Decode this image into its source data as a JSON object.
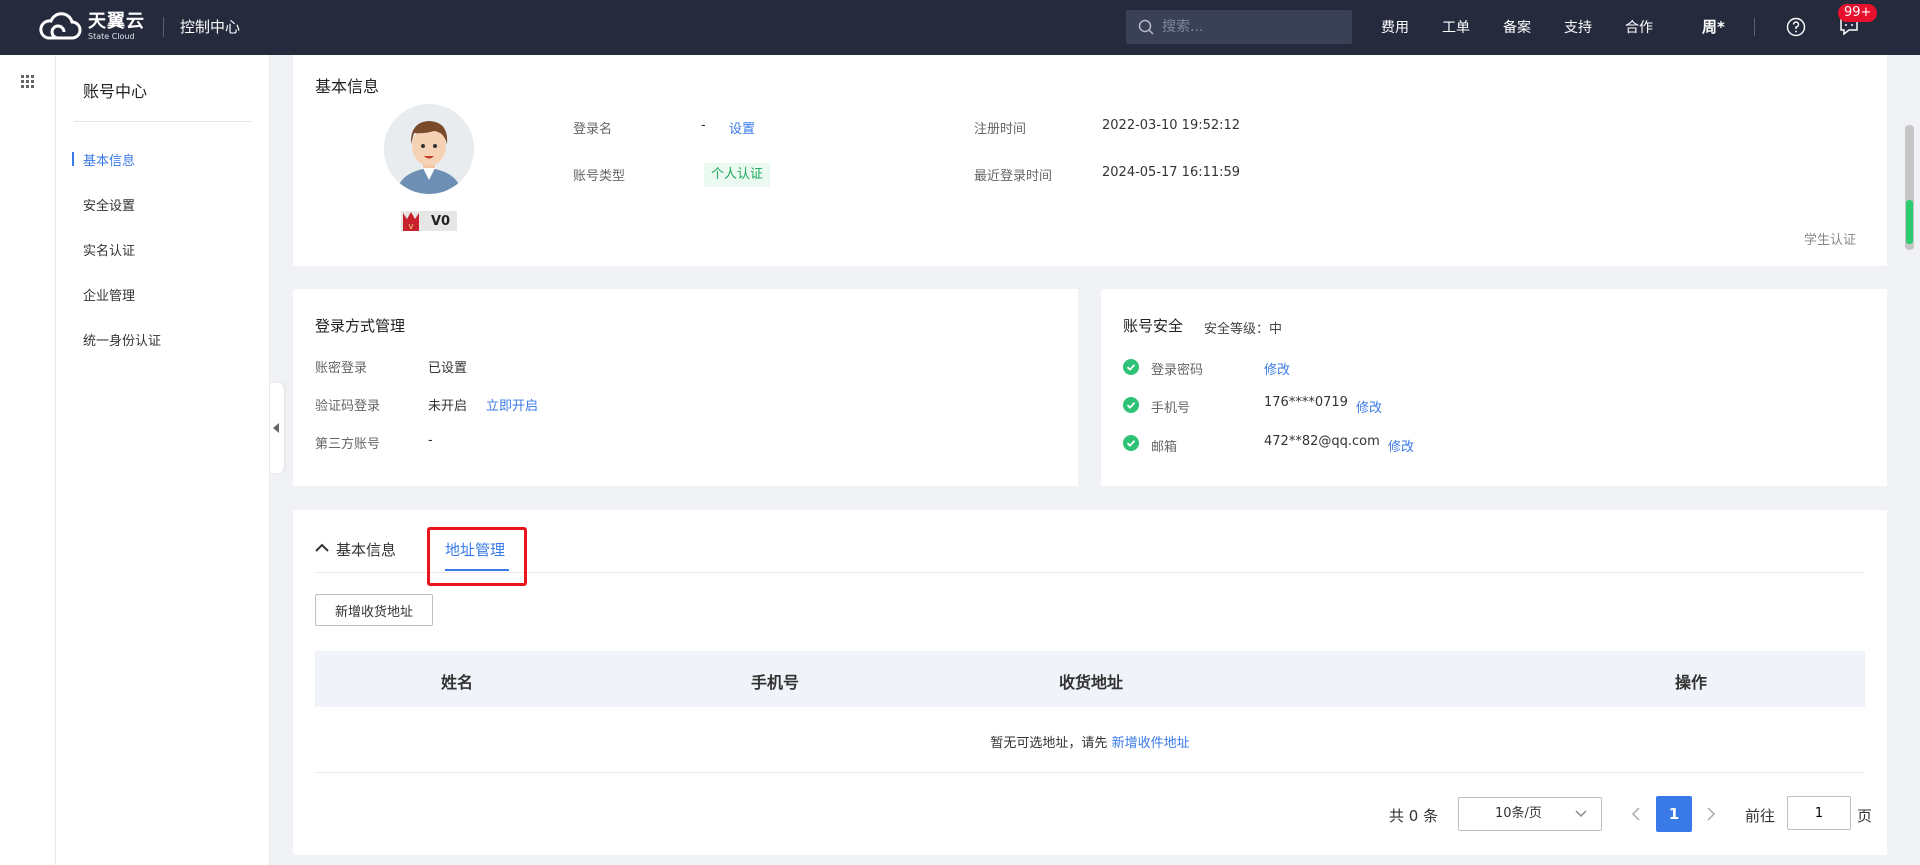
{
  "topbar": {
    "logo_cn": "天翼云",
    "logo_en": "State Cloud",
    "console_title": "控制中心",
    "search_placeholder": "搜索...",
    "nav": [
      "费用",
      "工单",
      "备案",
      "支持",
      "合作"
    ],
    "user": "周*",
    "badge": "99+"
  },
  "sidebar": {
    "title": "账号中心",
    "items": [
      {
        "label": "基本信息",
        "active": true
      },
      {
        "label": "安全设置",
        "active": false
      },
      {
        "label": "实名认证",
        "active": false
      },
      {
        "label": "企业管理",
        "active": false
      },
      {
        "label": "统一身份认证",
        "active": false
      }
    ]
  },
  "basic_info": {
    "title": "基本信息",
    "level": "V0",
    "login_name_label": "登录名",
    "login_name_value": "-",
    "login_name_action": "设置",
    "account_type_label": "账号类型",
    "account_type_value": "个人认证",
    "register_time_label": "注册时间",
    "register_time_value": "2022-03-10 19:52:12",
    "last_login_label": "最近登录时间",
    "last_login_value": "2024-05-17 16:11:59",
    "student_auth": "学生认证"
  },
  "login_methods": {
    "title": "登录方式管理",
    "rows": [
      {
        "label": "账密登录",
        "value": "已设置",
        "action": ""
      },
      {
        "label": "验证码登录",
        "value": "未开启",
        "action": "立即开启"
      },
      {
        "label": "第三方账号",
        "value": "-",
        "action": ""
      }
    ]
  },
  "account_security": {
    "title": "账号安全",
    "level": "安全等级：中",
    "rows": [
      {
        "label": "登录密码",
        "value": "",
        "action": "修改"
      },
      {
        "label": "手机号",
        "value": "176****0719",
        "action": "修改"
      },
      {
        "label": "邮箱",
        "value": "472**82@qq.com",
        "action": "修改"
      }
    ]
  },
  "address": {
    "tab_basic": "基本信息",
    "tab_address": "地址管理",
    "add_button": "新增收货地址",
    "columns": [
      "姓名",
      "手机号",
      "收货地址",
      "操作"
    ],
    "empty_text": "暂无可选地址，请先",
    "empty_link": "新增收件地址",
    "pager": {
      "total": "共 0 条",
      "page_size": "10条/页",
      "current_page": "1",
      "goto_label": "前往",
      "goto_value": "1",
      "goto_unit": "页"
    }
  },
  "colors": {
    "topbar_bg": "#252a3d",
    "accent": "#3a7ae8",
    "success": "#1ca85a",
    "highlight": "#e8141d"
  }
}
